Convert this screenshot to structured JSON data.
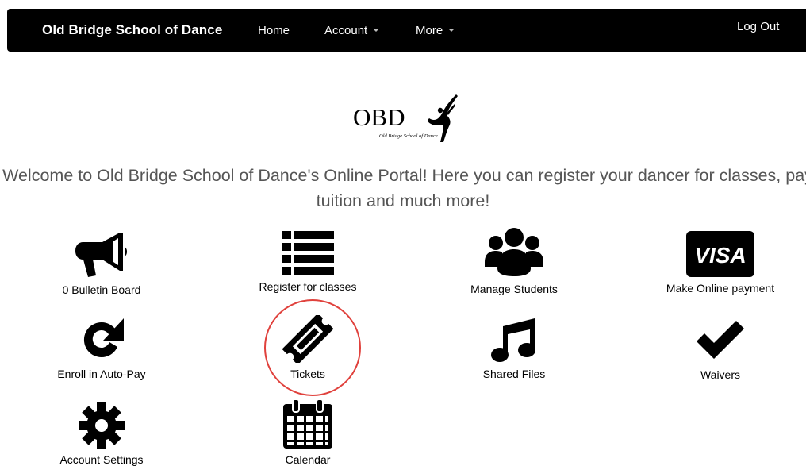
{
  "navbar": {
    "brand": "Old Bridge School of Dance",
    "links": [
      {
        "label": "Home"
      },
      {
        "label": "Account"
      },
      {
        "label": "More"
      }
    ],
    "logout": "Log Out"
  },
  "logo": {
    "text": "OBD",
    "tagline": "Old Bridge School of Dance"
  },
  "welcome": {
    "line1": "Welcome to Old Bridge School of Dance's Online Portal! Here you can register your dancer for classes, pay",
    "line2": "tuition and much more!"
  },
  "tiles": [
    {
      "label": "0 Bulletin Board",
      "icon": "megaphone-icon"
    },
    {
      "label": "Register for classes",
      "icon": "list-icon"
    },
    {
      "label": "Manage Students",
      "icon": "users-icon"
    },
    {
      "label": "Make Online payment",
      "icon": "visa-card-icon",
      "icon_text": "VISA"
    },
    {
      "label": "Enroll in Auto-Pay",
      "icon": "refresh-icon"
    },
    {
      "label": "Tickets",
      "icon": "ticket-icon",
      "highlighted": true
    },
    {
      "label": "Shared Files",
      "icon": "music-note-icon"
    },
    {
      "label": "Waivers",
      "icon": "checkmark-icon"
    },
    {
      "label": "Account Settings",
      "icon": "gear-icon"
    },
    {
      "label": "Calendar",
      "icon": "calendar-icon"
    }
  ],
  "colors": {
    "navbar_bg": "#000000",
    "highlight_ring": "#e0413c",
    "welcome_text": "#555555"
  }
}
